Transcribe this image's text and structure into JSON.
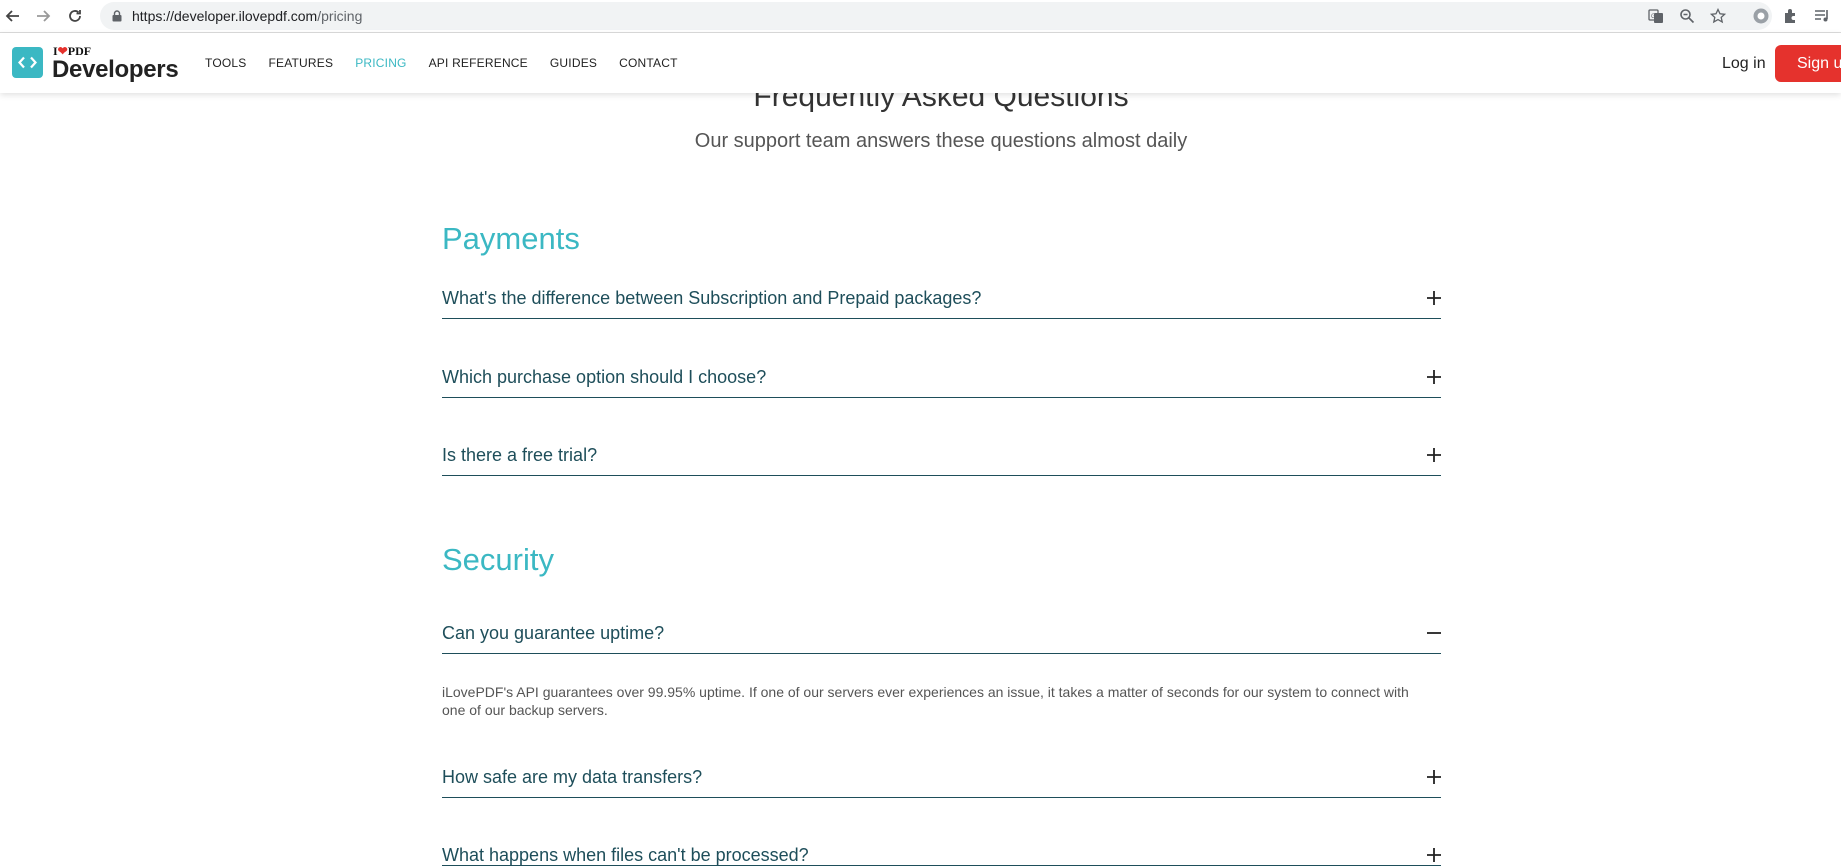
{
  "browser": {
    "url_host": "https://developer.ilovepdf.com",
    "url_path": "/pricing"
  },
  "header": {
    "logo_top": "I❤PDF",
    "logo_main": "Developers",
    "nav": [
      "TOOLS",
      "FEATURES",
      "PRICING",
      "API REFERENCE",
      "GUIDES",
      "CONTACT"
    ],
    "active_nav": "PRICING",
    "login_label": "Log in",
    "signup_label": "Sign up"
  },
  "faq": {
    "title": "Frequently Asked Questions",
    "subtitle": "Our support team answers these questions almost daily",
    "sections": [
      {
        "title": "Payments",
        "items": [
          {
            "question": "What's the difference between Subscription and Prepaid packages?",
            "expanded": false
          },
          {
            "question": "Which purchase option should I choose?",
            "expanded": false
          },
          {
            "question": "Is there a free trial?",
            "expanded": false
          }
        ]
      },
      {
        "title": "Security",
        "items": [
          {
            "question": "Can you guarantee uptime?",
            "expanded": true,
            "answer": "iLovePDF's API guarantees over 99.95% uptime. If one of our servers ever experiences an issue, it takes a matter of seconds for our system to connect with one of our backup servers."
          },
          {
            "question": "How safe are my data transfers?",
            "expanded": false
          },
          {
            "question": "What happens when files can't be processed?",
            "expanded": false
          }
        ]
      }
    ]
  },
  "colors": {
    "accent": "#3bb8c3",
    "brand_red": "#e5322d",
    "question_text": "#1e4e5a"
  }
}
